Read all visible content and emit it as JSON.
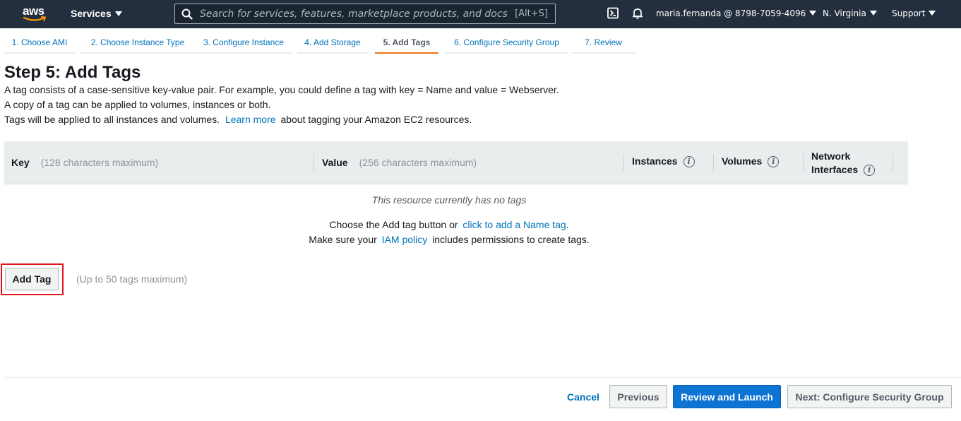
{
  "colors": {
    "topnav_bg": "#232f3e",
    "link": "#0073bb",
    "active_tab_underline": "#ec7211",
    "primary_button": "#0d74d4",
    "highlight_border": "#e0151b"
  },
  "topnav": {
    "logo_text": "aws",
    "services_label": "Services",
    "search_placeholder": "Search for services, features, marketplace products, and docs",
    "search_shortcut": "[Alt+S]",
    "account_label": "maria.fernanda @ 8798-7059-4096",
    "region_label": "N. Virginia",
    "support_label": "Support",
    "icons": [
      "terminal-icon",
      "bell-icon"
    ]
  },
  "wizard": {
    "tabs": [
      {
        "label": "1. Choose AMI"
      },
      {
        "label": "2. Choose Instance Type"
      },
      {
        "label": "3. Configure Instance"
      },
      {
        "label": "4. Add Storage"
      },
      {
        "label": "5. Add Tags",
        "active": true
      },
      {
        "label": "6. Configure Security Group"
      },
      {
        "label": "7. Review"
      }
    ]
  },
  "main": {
    "title": "Step 5: Add Tags",
    "desc_line1": "A tag consists of a case-sensitive key-value pair. For example, you could define a tag with key = Name and value = Webserver.",
    "desc_line2": "A copy of a tag can be applied to volumes, instances or both.",
    "desc_line3_pre": "Tags will be applied to all instances and volumes.",
    "desc_line3_link": "Learn more",
    "desc_line3_post": "about tagging your Amazon EC2 resources."
  },
  "table": {
    "key_label": "Key",
    "key_hint": "(128 characters maximum)",
    "value_label": "Value",
    "value_hint": "(256 characters maximum)",
    "instances_label": "Instances",
    "volumes_label": "Volumes",
    "network_label_1": "Network",
    "network_label_2": "Interfaces",
    "empty_text": "This resource currently has no tags",
    "choose_pre": "Choose the Add tag button or",
    "choose_link": "click to add a Name tag",
    "choose_post": ".",
    "iam_pre": "Make sure your",
    "iam_link": "IAM policy",
    "iam_post": "includes permissions to create tags."
  },
  "add_tag": {
    "button_label": "Add Tag",
    "max_hint": "(Up to 50 tags maximum)"
  },
  "footer": {
    "cancel_label": "Cancel",
    "previous_label": "Previous",
    "review_launch_label": "Review and Launch",
    "next_label": "Next: Configure Security Group"
  }
}
